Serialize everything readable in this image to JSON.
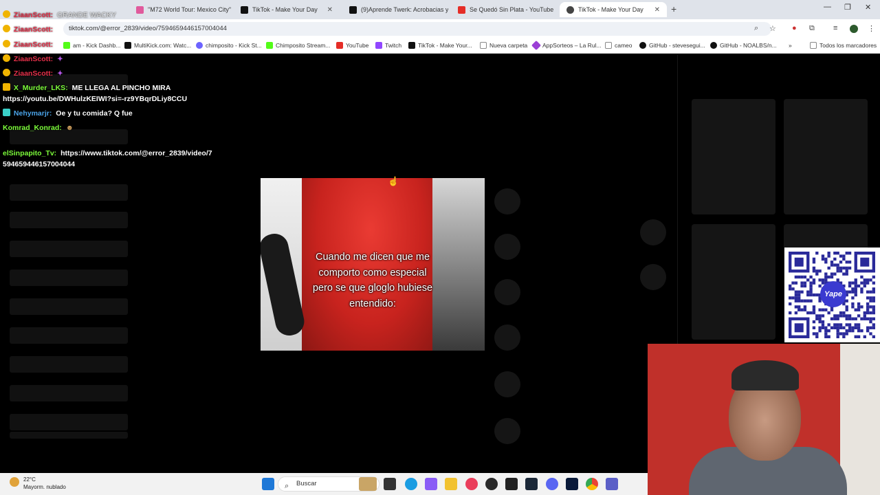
{
  "browser": {
    "tabs": [
      {
        "label": "\"M72 World Tour: Mexico City\"",
        "icon_color": "#e05a9c",
        "active": false
      },
      {
        "label": "TikTok - Make Your Day",
        "icon_color": "#111111",
        "active": false
      },
      {
        "label": "(9)Aprende Twerk: Acrobacias y",
        "icon_color": "#111111",
        "active": false
      },
      {
        "label": "Se Quedó Sin Plata - YouTube",
        "icon_color": "#e52d27",
        "active": false
      },
      {
        "label": "TikTok - Make Your Day",
        "icon_color": "#444444",
        "active": true
      }
    ],
    "new_tab_symbol": "+",
    "address": "tiktok.com/@error_2839/video/7594659446157004044",
    "bookmarks": [
      {
        "label": "am - Kick Dashb...",
        "icon_color": "#53fc18"
      },
      {
        "label": "MultiKick.com: Watc...",
        "icon_color": "#111111"
      },
      {
        "label": "chimposito - Kick St...",
        "icon_color": "#6c63ff"
      },
      {
        "label": "Chimposito Stream...",
        "icon_color": "#53fc18"
      },
      {
        "label": "YouTube",
        "icon_color": "#e52d27"
      },
      {
        "label": "Twitch",
        "icon_color": "#9146ff"
      },
      {
        "label": "TikTok - Make Your...",
        "icon_color": "#111111"
      },
      {
        "label": "Nueva carpeta",
        "icon_color": "#888888"
      },
      {
        "label": "AppSorteos – La Rul...",
        "icon_color": "#9b3fd6"
      },
      {
        "label": "cameo",
        "icon_color": "#888888"
      },
      {
        "label": "GitHub - stevesegui...",
        "icon_color": "#111111"
      },
      {
        "label": "GitHub - NOALBS/n...",
        "icon_color": "#111111"
      }
    ],
    "bookmarks_overflow": "»",
    "all_bookmarks": "Todos los marcadores"
  },
  "chat": {
    "messages": [
      {
        "user": "ZiaanScott:",
        "text": "GRANDE WACKY",
        "user_color": "#e8304a"
      },
      {
        "user": "ZiaanScott:",
        "text": "",
        "user_color": "#e8304a"
      },
      {
        "user": "ZiaanScott:",
        "text": "",
        "user_color": "#e8304a"
      },
      {
        "user": "ZiaanScott:",
        "text": "",
        "user_color": "#e8304a"
      },
      {
        "user": "ZiaanScott:",
        "text": "",
        "user_color": "#e8304a"
      },
      {
        "user": "X_Murder_LKS:",
        "text": "ME LLEGA AL PINCHO MIRA",
        "text2": "https://youtu.be/DWHulzKEIWI?si=-rz9YBqrDLiy8CCU",
        "user_color": "#7cfc3a"
      },
      {
        "user": "Nehymarjr:",
        "text": "Oe y tu comida? Q fue",
        "user_color": "#4aa3e8"
      },
      {
        "user": "Komrad_Konrad:",
        "text": "",
        "user_color": "#7cfc3a"
      },
      {
        "user": "elSinpapito_Tv:",
        "text": "https://www.tiktok.com/@error_2839/video/7",
        "text2": "594659446157004044",
        "user_color": "#7cfc3a"
      }
    ]
  },
  "video": {
    "caption": "Cuando me dicen que me\ncomporto como especial\npero se que gloglo hubiese\nentendido:"
  },
  "qr": {
    "logo_text": "Yape"
  },
  "taskbar": {
    "temp": "22°C",
    "weather": "Mayorm. nublado",
    "search_placeholder": "Buscar",
    "search_icon": "search-icon"
  },
  "colors": {
    "accent_red": "#e8304a",
    "accent_green": "#7cfc3a",
    "page_bg": "#000000"
  }
}
